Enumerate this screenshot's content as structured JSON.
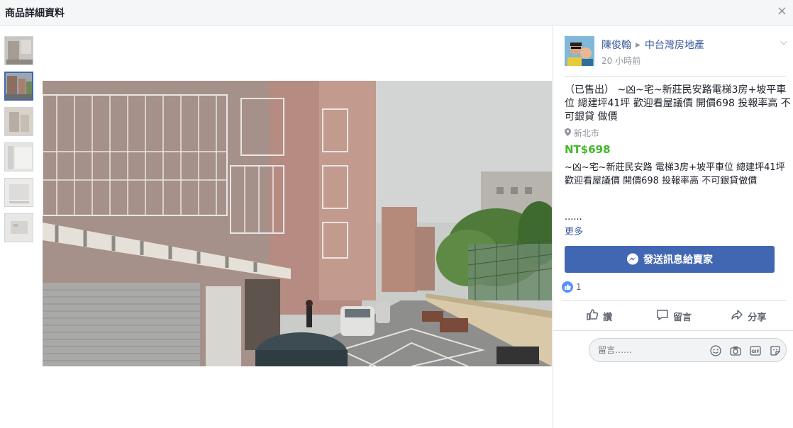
{
  "dialog": {
    "title": "商品詳細資料",
    "close_icon": "×"
  },
  "thumbnails": [
    {
      "name": "thumb-1",
      "active": false
    },
    {
      "name": "thumb-2",
      "active": true
    },
    {
      "name": "thumb-3",
      "active": false
    },
    {
      "name": "thumb-4",
      "active": false
    },
    {
      "name": "thumb-5",
      "active": false
    },
    {
      "name": "thumb-6",
      "active": false
    }
  ],
  "seller": {
    "name": "陳俊翰",
    "group": "中台灣房地產",
    "time": "20 小時前"
  },
  "listing": {
    "title": "（已售出） ~凶~宅~新莊民安路電梯3房+坡平車位 總建坪41坪 歡迎看屋議價 開價698 投報率高 不可銀貸 做價",
    "location": "新北市",
    "price": "NT$698",
    "description": "~凶~宅~新莊民安路 電梯3房+坡平車位 總建坪41坪 歡迎看屋議價 開價698 投報率高 不可銀貸做價",
    "ellipsis": "......",
    "more": "更多"
  },
  "message_button": "發送訊息給賣家",
  "reactions": {
    "count": "1"
  },
  "actions": {
    "like": "讚",
    "comment": "留言",
    "share": "分享"
  },
  "comment": {
    "placeholder": "留言……"
  },
  "colors": {
    "accent": "#4267b2",
    "price": "#42b72a",
    "link": "#365899"
  }
}
